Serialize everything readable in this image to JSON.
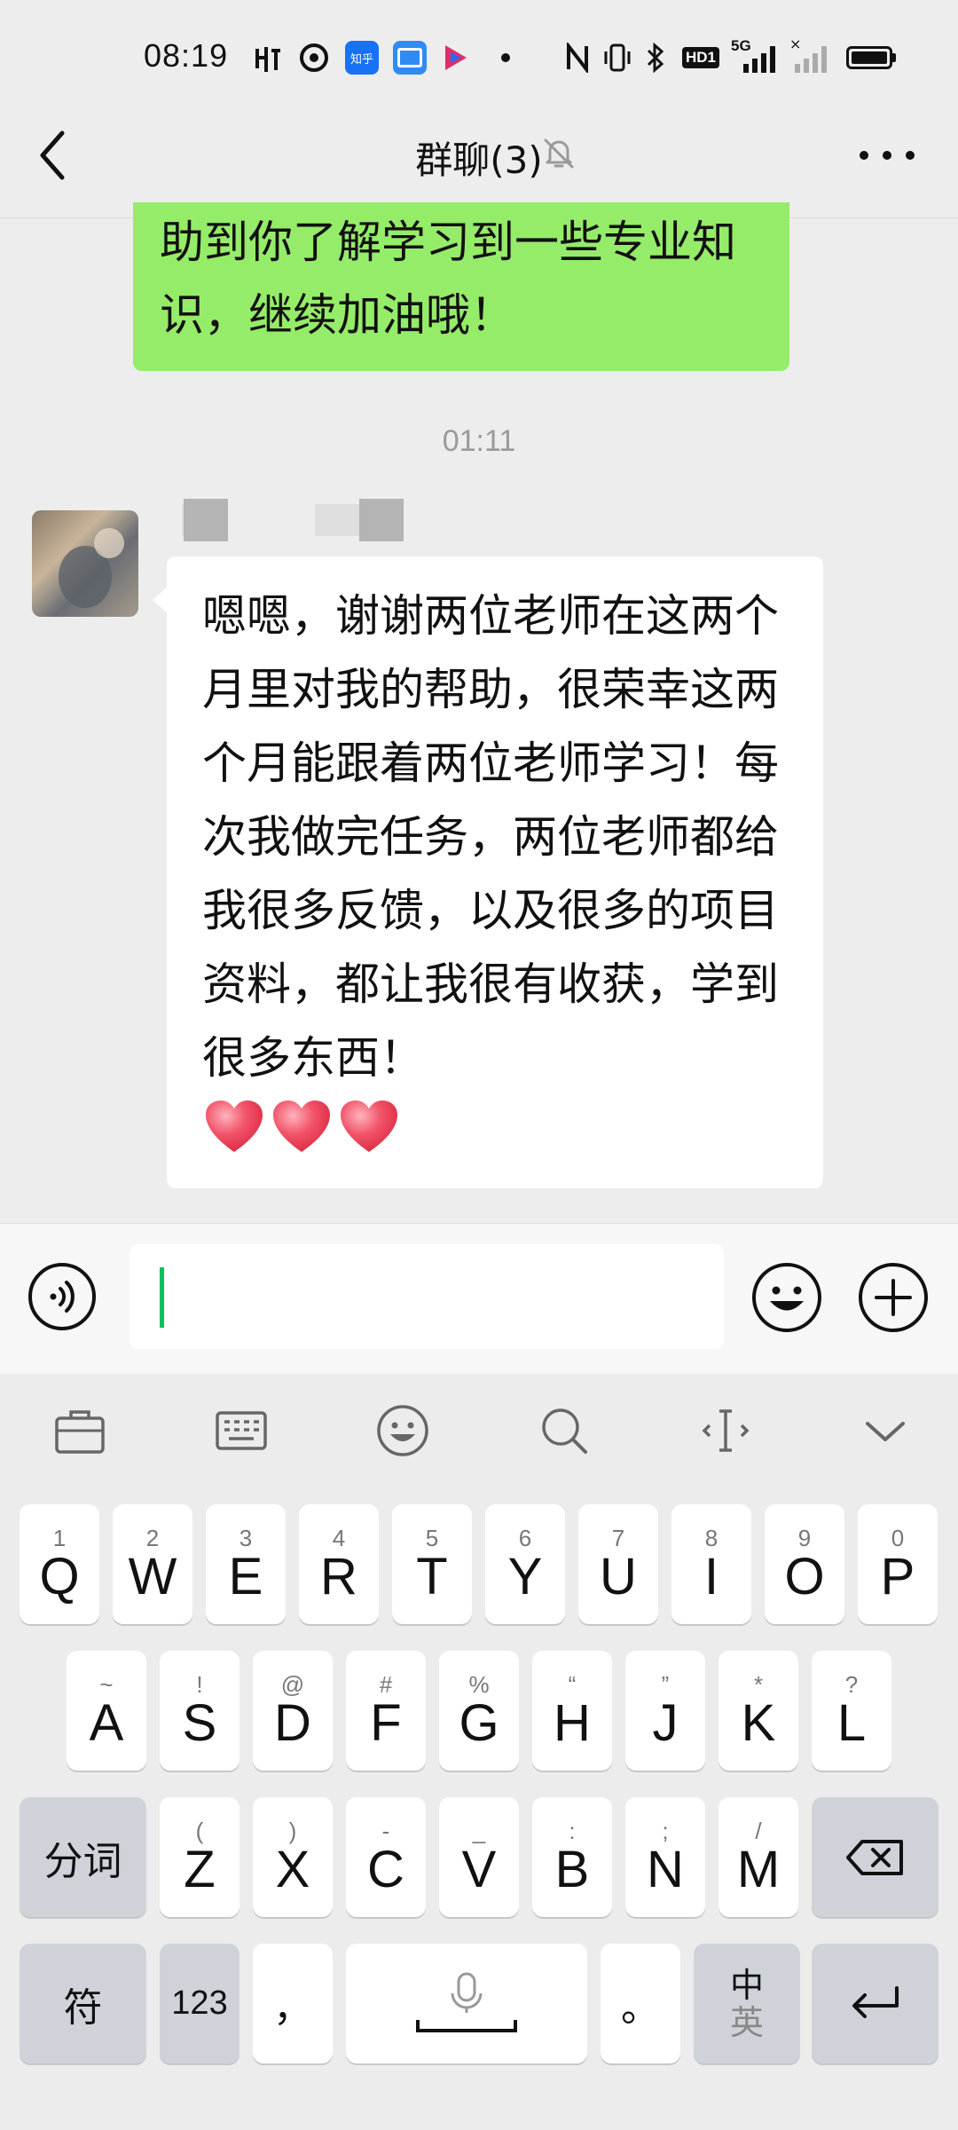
{
  "status_bar": {
    "time": "08:19",
    "network": "5G",
    "app_icons": [
      "pacer-icon",
      "netease-icon",
      "zhihu-icon",
      "tablet-app-icon",
      "video-app-icon"
    ],
    "zhihu_label": "知乎",
    "hd_badge": "HD1"
  },
  "header": {
    "title": "群聊(3)",
    "muted": true
  },
  "messages": {
    "outgoing_text": "助到你了解学习到一些专业知识，继续加油哦！",
    "timestamp": "01:11",
    "incoming_text": "嗯嗯，谢谢两位老师在这两个月里对我的帮助，很荣幸这两个月能跟着两位老师学习！每次我做完任务，两位老师都给我很多反馈，以及很多的项目资料，都让我很有收获，学到很多东西！",
    "incoming_emoji": [
      "❤",
      "❤",
      "❤"
    ]
  },
  "input": {
    "value": ""
  },
  "keyboard": {
    "toolbar": [
      "toolbox-icon",
      "keyboard-icon",
      "emoji-icon",
      "search-icon",
      "cursor-move-icon",
      "collapse-icon"
    ],
    "row1": [
      {
        "sub": "1",
        "main": "Q"
      },
      {
        "sub": "2",
        "main": "W"
      },
      {
        "sub": "3",
        "main": "E"
      },
      {
        "sub": "4",
        "main": "R"
      },
      {
        "sub": "5",
        "main": "T"
      },
      {
        "sub": "6",
        "main": "Y"
      },
      {
        "sub": "7",
        "main": "U"
      },
      {
        "sub": "8",
        "main": "I"
      },
      {
        "sub": "9",
        "main": "O"
      },
      {
        "sub": "0",
        "main": "P"
      }
    ],
    "row2": [
      {
        "sub": "~",
        "main": "A"
      },
      {
        "sub": "!",
        "main": "S"
      },
      {
        "sub": "@",
        "main": "D"
      },
      {
        "sub": "#",
        "main": "F"
      },
      {
        "sub": "%",
        "main": "G"
      },
      {
        "sub": "“",
        "main": "H"
      },
      {
        "sub": "”",
        "main": "J"
      },
      {
        "sub": "*",
        "main": "K"
      },
      {
        "sub": "?",
        "main": "L"
      }
    ],
    "row3": [
      {
        "sub": "(",
        "main": "Z"
      },
      {
        "sub": ")",
        "main": "X"
      },
      {
        "sub": "-",
        "main": "C"
      },
      {
        "sub": "_",
        "main": "V"
      },
      {
        "sub": ":",
        "main": "B"
      },
      {
        "sub": ";",
        "main": "N"
      },
      {
        "sub": "/",
        "main": "M"
      }
    ],
    "segment_key": "分词",
    "symbol_key": "符",
    "num_key": "123",
    "comma_key": "，",
    "period_key": "。",
    "lang_key_top": "中",
    "lang_key_bottom": "英"
  }
}
